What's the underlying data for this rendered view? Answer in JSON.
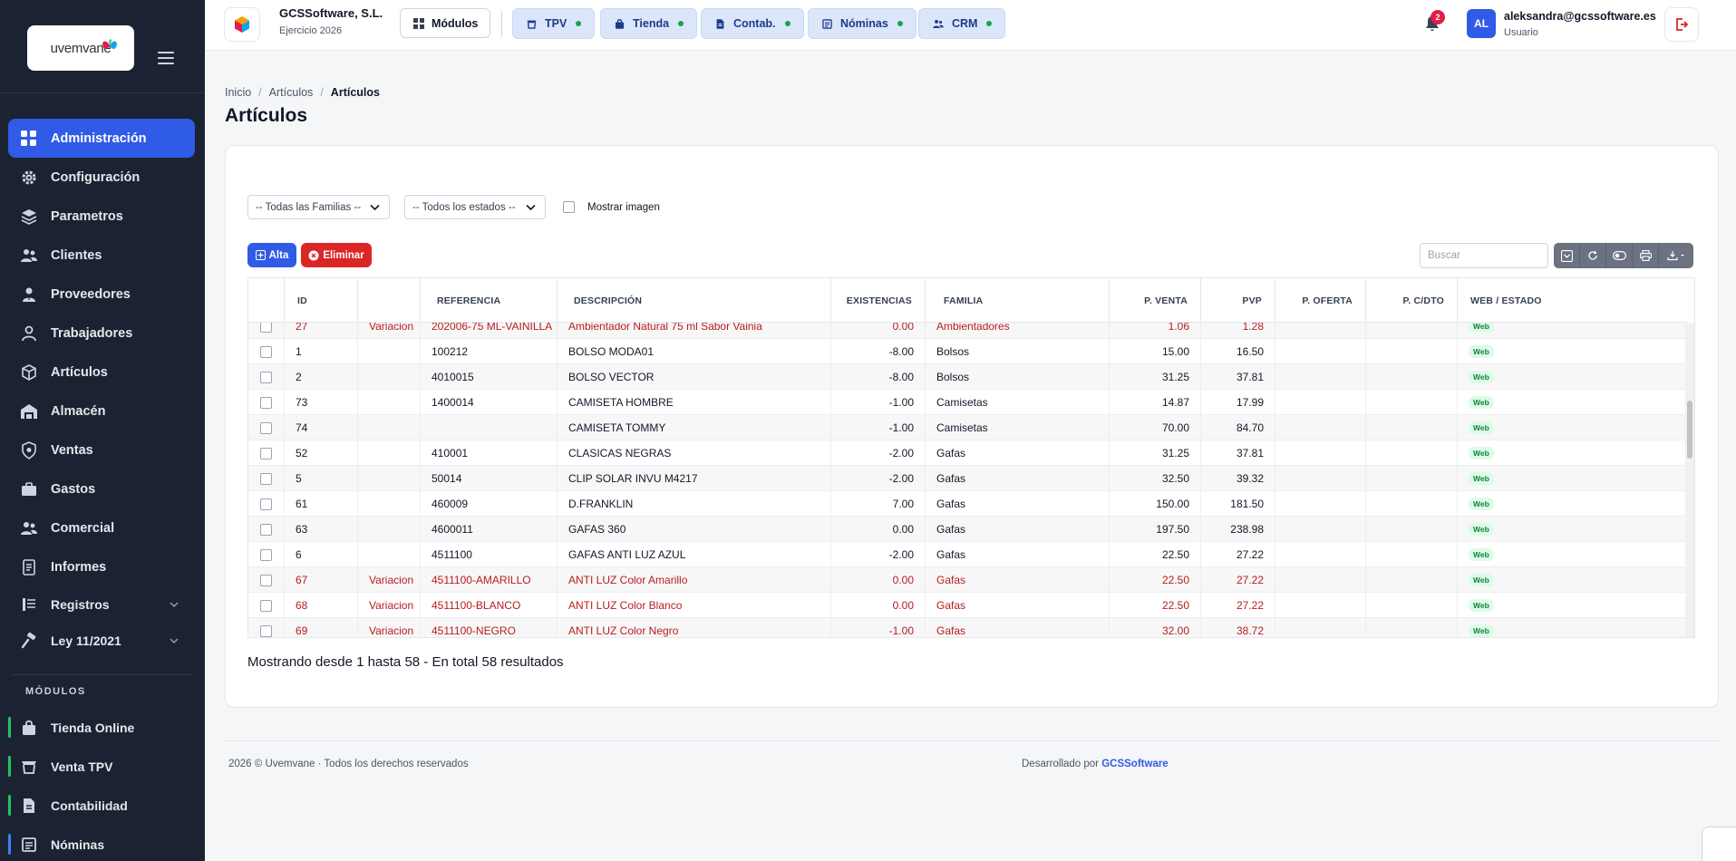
{
  "sidebar": {
    "logo_text": "uvemvane",
    "nav": [
      {
        "label": "Administración",
        "icon": "grid-icon",
        "active": true
      },
      {
        "label": "Configuración",
        "icon": "gear-icon"
      },
      {
        "label": "Parametros",
        "icon": "layers-icon"
      },
      {
        "label": "Clientes",
        "icon": "users-icon"
      },
      {
        "label": "Proveedores",
        "icon": "user-tie-icon"
      },
      {
        "label": "Trabajadores",
        "icon": "user-icon"
      },
      {
        "label": "Artículos",
        "icon": "box-icon"
      },
      {
        "label": "Almacén",
        "icon": "warehouse-icon"
      },
      {
        "label": "Ventas",
        "icon": "shield-icon"
      },
      {
        "label": "Gastos",
        "icon": "briefcase-icon"
      },
      {
        "label": "Comercial",
        "icon": "users-icon"
      },
      {
        "label": "Informes",
        "icon": "document-icon"
      },
      {
        "label": "Registros",
        "icon": "registry-icon",
        "expandable": true
      },
      {
        "label": "Ley 11/2021",
        "icon": "gavel-icon",
        "expandable": true
      }
    ],
    "modulos_title": "MÓDULOS",
    "modules": [
      {
        "label": "Tienda Online",
        "icon": "bag-icon",
        "accent": "green"
      },
      {
        "label": "Venta TPV",
        "icon": "cart-icon",
        "accent": "green"
      },
      {
        "label": "Contabilidad",
        "icon": "document-icon",
        "accent": "green"
      },
      {
        "label": "Nóminas",
        "icon": "payroll-icon",
        "accent": "blue"
      }
    ]
  },
  "topbar": {
    "company_name": "GCSSoftware, S.L.",
    "company_sub": "Ejercicio 2026",
    "modulos_label": "Módulos",
    "pills": [
      {
        "label": "TPV",
        "icon": "cart-icon"
      },
      {
        "label": "Tienda",
        "icon": "bag-icon"
      },
      {
        "label": "Contab.",
        "icon": "document-icon"
      },
      {
        "label": "Nóminas",
        "icon": "payroll-icon"
      },
      {
        "label": "CRM",
        "icon": "users-icon"
      }
    ],
    "notification_count": "2",
    "avatar_initials": "AL",
    "user_email": "aleksandra@gcssoftware.es",
    "user_role": "Usuario"
  },
  "breadcrumb": {
    "home": "Inicio",
    "parent": "Artículos",
    "current": "Artículos"
  },
  "page_title": "Artículos",
  "filters": {
    "familias": "-- Todas las Familias --",
    "estados": "-- Todos los estados --",
    "mostrar_imagen": "Mostrar imagen"
  },
  "actions": {
    "alta": "Alta",
    "eliminar": "Eliminar",
    "search_placeholder": "Buscar"
  },
  "table": {
    "headers": [
      "ID",
      "",
      "REFERENCIA",
      "DESCRIPCIÓN",
      "EXISTENCIAS",
      "FAMILIA",
      "P. VENTA",
      "PVP",
      "P. OFERTA",
      "P. C/DTO",
      "WEB / ESTADO"
    ],
    "rows": [
      {
        "id": "27",
        "tipo": "Variacion",
        "ref": "202006-75 ML-VAINILLA",
        "desc": "Ambientador Natural 75 ml Sabor Vainia",
        "exist": "0.00",
        "familia": "Ambientadores",
        "venta": "1.06",
        "pvp": "1.28",
        "estado": "Web",
        "variation": true
      },
      {
        "id": "1",
        "tipo": "",
        "ref": "100212",
        "desc": "BOLSO MODA01",
        "exist": "-8.00",
        "familia": "Bolsos",
        "venta": "15.00",
        "pvp": "16.50",
        "estado": "Web"
      },
      {
        "id": "2",
        "tipo": "",
        "ref": "4010015",
        "desc": "BOLSO VECTOR",
        "exist": "-8.00",
        "familia": "Bolsos",
        "venta": "31.25",
        "pvp": "37.81",
        "estado": "Web"
      },
      {
        "id": "73",
        "tipo": "",
        "ref": "1400014",
        "desc": "CAMISETA HOMBRE",
        "exist": "-1.00",
        "familia": "Camisetas",
        "venta": "14.87",
        "pvp": "17.99",
        "estado": "Web"
      },
      {
        "id": "74",
        "tipo": "",
        "ref": "",
        "desc": "CAMISETA TOMMY",
        "exist": "-1.00",
        "familia": "Camisetas",
        "venta": "70.00",
        "pvp": "84.70",
        "estado": "Web"
      },
      {
        "id": "52",
        "tipo": "",
        "ref": "410001",
        "desc": "CLASICAS NEGRAS",
        "exist": "-2.00",
        "familia": "Gafas",
        "venta": "31.25",
        "pvp": "37.81",
        "estado": "Web"
      },
      {
        "id": "5",
        "tipo": "",
        "ref": "50014",
        "desc": "CLIP SOLAR INVU M4217",
        "exist": "-2.00",
        "familia": "Gafas",
        "venta": "32.50",
        "pvp": "39.32",
        "estado": "Web"
      },
      {
        "id": "61",
        "tipo": "",
        "ref": "460009",
        "desc": "D.FRANKLIN",
        "exist": "7.00",
        "familia": "Gafas",
        "venta": "150.00",
        "pvp": "181.50",
        "estado": "Web"
      },
      {
        "id": "63",
        "tipo": "",
        "ref": "4600011",
        "desc": "GAFAS 360",
        "exist": "0.00",
        "familia": "Gafas",
        "venta": "197.50",
        "pvp": "238.98",
        "estado": "Web"
      },
      {
        "id": "6",
        "tipo": "",
        "ref": "4511100",
        "desc": "GAFAS ANTI LUZ AZUL",
        "exist": "-2.00",
        "familia": "Gafas",
        "venta": "22.50",
        "pvp": "27.22",
        "estado": "Web"
      },
      {
        "id": "67",
        "tipo": "Variacion",
        "ref": "4511100-AMARILLO",
        "desc": "ANTI LUZ Color Amarillo",
        "exist": "0.00",
        "familia": "Gafas",
        "venta": "22.50",
        "pvp": "27.22",
        "estado": "Web",
        "variation": true
      },
      {
        "id": "68",
        "tipo": "Variacion",
        "ref": "4511100-BLANCO",
        "desc": "ANTI LUZ Color Blanco",
        "exist": "0.00",
        "familia": "Gafas",
        "venta": "22.50",
        "pvp": "27.22",
        "estado": "Web",
        "variation": true
      },
      {
        "id": "69",
        "tipo": "Variacion",
        "ref": "4511100-NEGRO",
        "desc": "ANTI LUZ Color Negro",
        "exist": "-1.00",
        "familia": "Gafas",
        "venta": "32.00",
        "pvp": "38.72",
        "estado": "Web",
        "variation": true
      }
    ]
  },
  "summary": "Mostrando desde 1 hasta 58 - En total 58 resultados",
  "footer": {
    "left": "2026 © Uvemvane · Todos los derechos reservados",
    "right_prefix": "Desarrollado por ",
    "right_brand": "GCSSoftware"
  },
  "colors": {
    "primary": "#2f5be6",
    "danger": "#dc2626",
    "sidebar_bg": "#1b2333",
    "variation_text": "#b91c1c",
    "web_badge": "#15803d"
  }
}
